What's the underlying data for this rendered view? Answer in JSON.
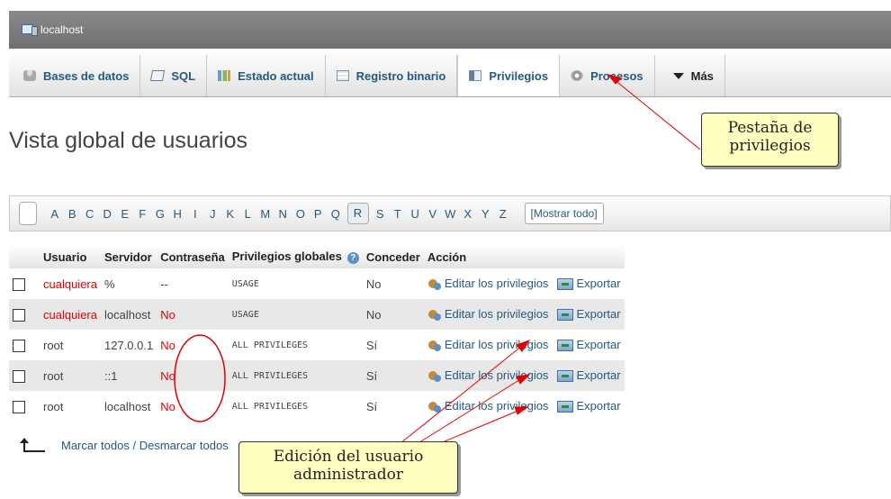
{
  "titlebar": {
    "server": "localhost"
  },
  "tabs": [
    {
      "label": "Bases de datos"
    },
    {
      "label": "SQL"
    },
    {
      "label": "Estado actual"
    },
    {
      "label": "Registro binario"
    },
    {
      "label": "Privilegios"
    },
    {
      "label": "Procesos"
    },
    {
      "label": "Más"
    }
  ],
  "heading": "Vista global de usuarios",
  "alphabet": [
    "A",
    "B",
    "C",
    "D",
    "E",
    "F",
    "G",
    "H",
    "I",
    "J",
    "K",
    "L",
    "M",
    "N",
    "O",
    "P",
    "Q",
    "R",
    "S",
    "T",
    "U",
    "V",
    "W",
    "X",
    "Y",
    "Z"
  ],
  "alphabet_current": "R",
  "show_all": "[Mostrar todo]",
  "table": {
    "headers": [
      "Usuario",
      "Servidor",
      "Contraseña",
      "Privilegios globales",
      "Conceder",
      "Acción"
    ],
    "rows": [
      {
        "user": "cualquiera",
        "host": "%",
        "password": "--",
        "privileges": "USAGE",
        "grant": "No"
      },
      {
        "user": "cualquiera",
        "host": "localhost",
        "password": "No",
        "privileges": "USAGE",
        "grant": "No"
      },
      {
        "user": "root",
        "host": "127.0.0.1",
        "password": "No",
        "privileges": "ALL PRIVILEGES",
        "grant": "Sí"
      },
      {
        "user": "root",
        "host": "::1",
        "password": "No",
        "privileges": "ALL PRIVILEGES",
        "grant": "Sí"
      },
      {
        "user": "root",
        "host": "localhost",
        "password": "No",
        "privileges": "ALL PRIVILEGES",
        "grant": "Sí"
      }
    ],
    "edit_label": "Editar los privilegios",
    "export_label": "Exportar"
  },
  "checkall": "Marcar todos / Desmarcar todos",
  "annotations": {
    "tab_callout": [
      "Pestaña de",
      "privilegios"
    ],
    "admin_callout": [
      "Edición del usuario",
      "administrador"
    ]
  },
  "colors": {
    "accent": "#235a81",
    "highlight_red": "#e30000",
    "callout_bg": "#ffffc0"
  }
}
